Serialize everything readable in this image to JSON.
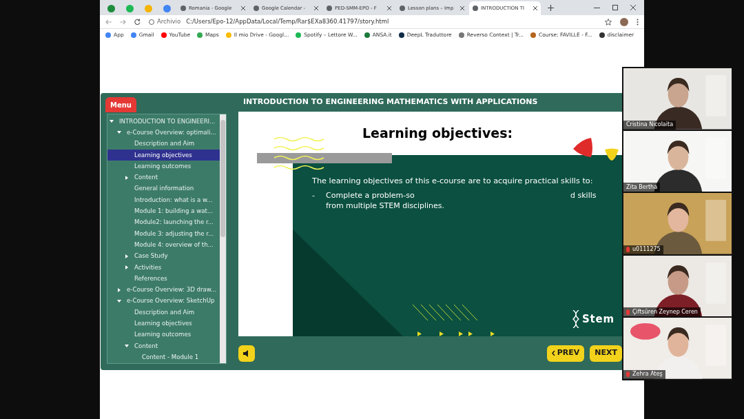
{
  "browser": {
    "tabs": [
      {
        "kind": "icon",
        "color": "#1e8e3e",
        "selected": false
      },
      {
        "kind": "icon",
        "color": "#1db954",
        "selected": false
      },
      {
        "kind": "icon",
        "color": "#f4b400",
        "selected": false
      },
      {
        "kind": "icon",
        "color": "#4285f4",
        "selected": false
      },
      {
        "kind": "labeled",
        "label": "Romania - Google",
        "selected": false
      },
      {
        "kind": "labeled",
        "label": "Google Calendar -",
        "selected": false
      },
      {
        "kind": "labeled",
        "label": "PED-SMM-EPO - F",
        "selected": false
      },
      {
        "kind": "labeled",
        "label": "Lesson plans – Imp",
        "selected": false
      },
      {
        "kind": "labeled",
        "label": "INTRODUCTION TI",
        "selected": true
      }
    ],
    "address": {
      "scheme": "Archivio",
      "url": "C:/Users/Epo-12/AppData/Local/Temp/Rar$EXa8360.41797/story.html"
    },
    "bookmarks": [
      {
        "label": "App",
        "color": "#4285f4"
      },
      {
        "label": "Gmail",
        "color": "#4285f4"
      },
      {
        "label": "YouTube",
        "color": "#ff0000"
      },
      {
        "label": "Maps",
        "color": "#34a853"
      },
      {
        "label": "Il mio Drive - Googl...",
        "color": "#fbbc04"
      },
      {
        "label": "Spotify – Lettore W...",
        "color": "#1db954"
      },
      {
        "label": "ANSA.it",
        "color": "#1a7a3a"
      },
      {
        "label": "DeepL Traduttore",
        "color": "#0f2b46"
      },
      {
        "label": "Reverso Context | Tr...",
        "color": "#777777"
      },
      {
        "label": "Course: FAVILLE - F...",
        "color": "#b5651d"
      },
      {
        "label": "disclaimer",
        "color": "#333333"
      }
    ]
  },
  "player": {
    "menu_button": "Menu",
    "title": "INTRODUCTION TO ENGINEERING MATHEMATICS WITH APPLICATIONS",
    "tree": [
      {
        "label": "INTRODUCTION TO ENGINEERI...",
        "selected": false,
        "expanded": true,
        "children": [
          {
            "label": "e-Course Overview: optimali...",
            "selected": false,
            "expanded": true,
            "children": [
              {
                "label": "Description and Aim",
                "selected": false
              },
              {
                "label": "Learning objectives",
                "selected": true
              },
              {
                "label": "Learning outcomes",
                "selected": false
              },
              {
                "label": "Content",
                "selected": false,
                "expanded": false
              },
              {
                "label": "General information",
                "selected": false
              },
              {
                "label": "Introduction: what is a w...",
                "selected": false
              },
              {
                "label": "Module 1: building a wat...",
                "selected": false
              },
              {
                "label": "Module2: launching the r...",
                "selected": false
              },
              {
                "label": "Module 3: adjusting the r...",
                "selected": false
              },
              {
                "label": "Module 4: overview of th...",
                "selected": false
              },
              {
                "label": "Case Study",
                "selected": false,
                "expanded": false
              },
              {
                "label": "Activities",
                "selected": false,
                "expanded": false
              },
              {
                "label": "References",
                "selected": false
              }
            ]
          },
          {
            "label": "e-Course Overview: 3D draw...",
            "selected": false,
            "expanded": false
          },
          {
            "label": "e-Course Overview: SketchUp",
            "selected": false,
            "expanded": true,
            "children": [
              {
                "label": "Description and Aim",
                "selected": false
              },
              {
                "label": "Learning objectives",
                "selected": false
              },
              {
                "label": "Learning outcomes",
                "selected": false
              },
              {
                "label": "Content",
                "selected": false,
                "expanded": true,
                "children": [
                  {
                    "label": "Content - Module 1",
                    "selected": false
                  }
                ]
              }
            ]
          }
        ]
      }
    ],
    "slide": {
      "heading": "Learning objectives:",
      "intro": "The learning objectives of this e-course are to acquire practical skills to:",
      "bullet": {
        "marker": "-",
        "start": "Complete a problem-so",
        "end": "d skills",
        "continuation": "from multiple STEM disciplines."
      },
      "logo": "Stem"
    },
    "prev_button": "PREV",
    "next_button": "NEXT"
  },
  "participants": [
    {
      "name": "Cristina Nicolaita",
      "muted": false
    },
    {
      "name": "Zita Bertha",
      "muted": false
    },
    {
      "name": "u0111275",
      "muted": true
    },
    {
      "name": "Çiftsüren Zeynep Ceren",
      "muted": true
    },
    {
      "name": "Zehra Ateş",
      "muted": true
    }
  ]
}
